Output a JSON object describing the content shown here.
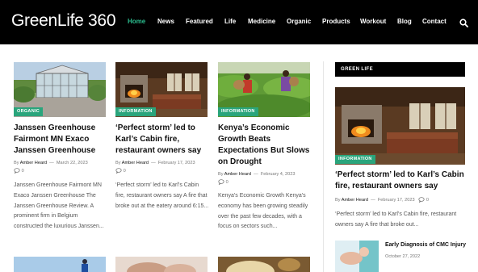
{
  "header": {
    "logo": "GreenLife 360",
    "nav": [
      {
        "label": "Home",
        "active": true
      },
      {
        "label": "News",
        "active": false
      },
      {
        "label": "Featured",
        "active": false
      },
      {
        "label": "Life",
        "active": false
      },
      {
        "label": "Medicine",
        "active": false
      },
      {
        "label": "Organic",
        "active": false
      },
      {
        "label": "Products",
        "active": false
      },
      {
        "label": "Workout",
        "active": false
      },
      {
        "label": "Blog",
        "active": false
      },
      {
        "label": "Contact",
        "active": false
      }
    ],
    "search_icon": "search-icon"
  },
  "posts": [
    {
      "category": "ORGANIC",
      "title": "Janssen Greenhouse Fairmont MN Exaco Janssen Greenhouse",
      "by": "By",
      "author": "Amber Heard",
      "date": "March 22, 2023",
      "comments": "0",
      "excerpt": "Janssen Greenhouse Fairmont MN Exaco Janssen Greenhouse The Janssen Greenhouse Review. A prominent firm in Belgium constructed the luxurious Janssen..."
    },
    {
      "category": "INFORMATION",
      "title": "‘Perfect storm’ led to Karl’s Cabin fire, restaurant owners say",
      "by": "By",
      "author": "Amber Heard",
      "date": "February 17, 2023",
      "comments": "0",
      "excerpt": "‘Perfect storm’ led to Karl’s Cabin fire, restaurant owners say A fire that broke out at the eatery around 6:15..."
    },
    {
      "category": "INFORMATION",
      "title": "Kenya’s Economic Growth Beats Expectations But Slows on Drought",
      "by": "By",
      "author": "Amber Heard",
      "date": "February 4, 2023",
      "comments": "0",
      "excerpt": "Kenya’s Economic Growth Kenya’s economy has been growing steadily over the past few decades, with a focus on sectors such..."
    }
  ],
  "sidebar": {
    "widget_title": "GREEN LIFE",
    "featured": {
      "category": "INFORMATION",
      "title": "‘Perfect storm’ led to Karl’s Cabin fire, restaurant owners say",
      "by": "By",
      "author": "Amber Heard",
      "date": "February 17, 2023",
      "comments": "0",
      "excerpt": "‘Perfect storm’ led to Karl’s Cabin fire, restaurant owners say A fire that broke out..."
    },
    "small_post": {
      "title": "Early Diagnosis of CMC Injury",
      "date": "October 27, 2022"
    }
  },
  "colors": {
    "accent": "#2bbd8e",
    "badge": "#2aa57c",
    "header_bg": "#000000"
  }
}
